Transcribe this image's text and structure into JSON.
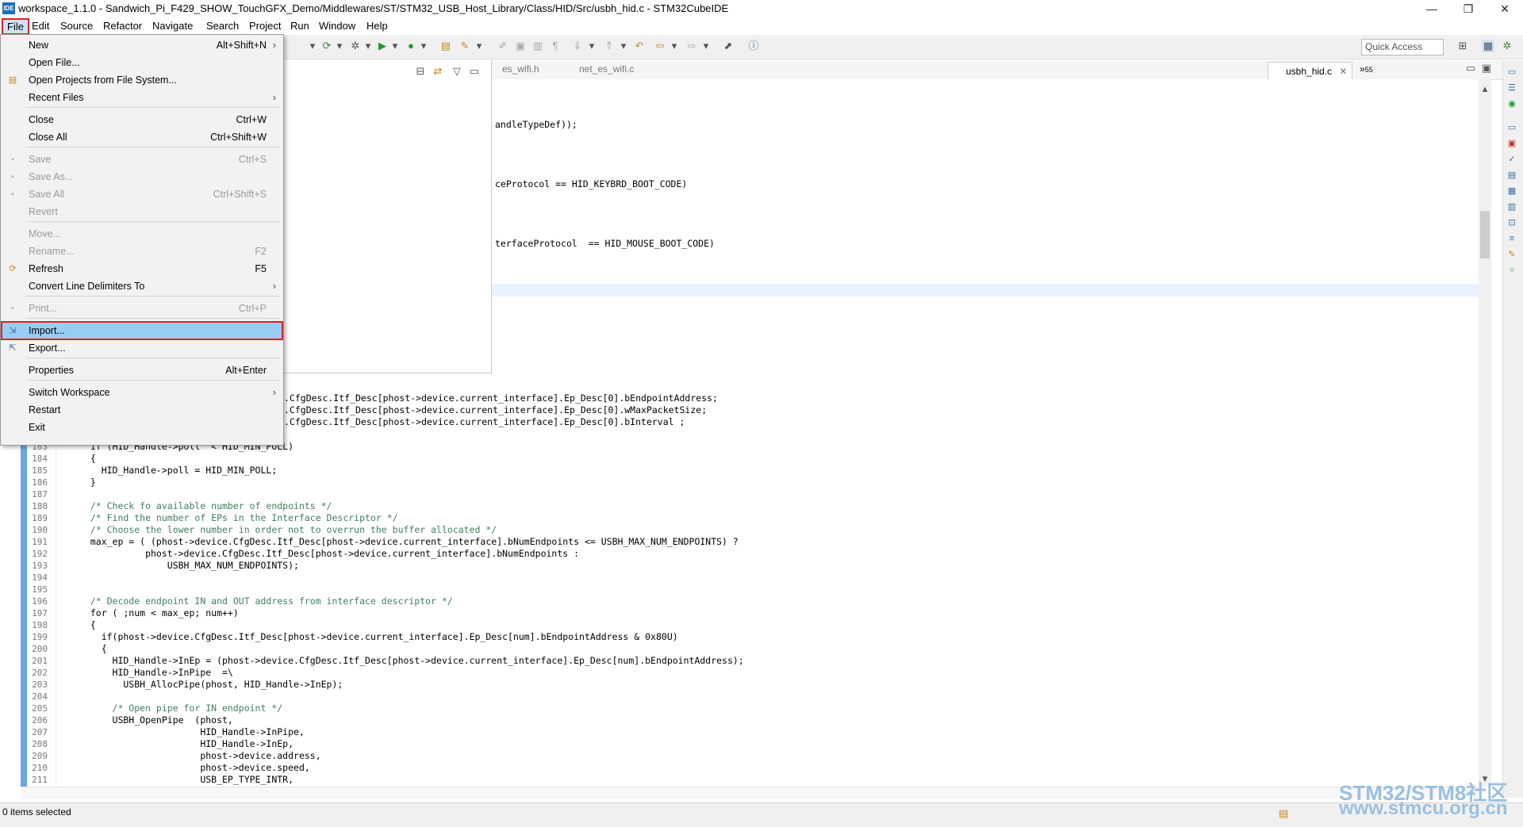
{
  "window": {
    "title": "workspace_1.1.0 - Sandwich_Pi_F429_SHOW_TouchGFX_Demo/Middlewares/ST/STM32_USB_Host_Library/Class/HID/Src/usbh_hid.c - STM32CubeIDE",
    "app_icon": "IDE",
    "minimize": "—",
    "maximize": "❐",
    "close": "✕"
  },
  "menubar": [
    "File",
    "Edit",
    "Source",
    "Refactor",
    "Navigate",
    "Search",
    "Project",
    "Run",
    "Window",
    "Help"
  ],
  "toolbar": {
    "quick_access_placeholder": "Quick Access"
  },
  "tabs": {
    "tab1": "es_wifi.h",
    "tab2": "net_es_wifi.c",
    "active": "usbh_hid.c",
    "overflow": "»",
    "overflow_count": "55"
  },
  "file_menu": {
    "items": [
      {
        "label": "New",
        "shortcut": "Alt+Shift+N",
        "submenu": true,
        "enabled": true
      },
      {
        "label": "Open File...",
        "shortcut": "",
        "enabled": true
      },
      {
        "label": "Open Projects from File System...",
        "shortcut": "",
        "enabled": true
      },
      {
        "label": "Recent Files",
        "shortcut": "",
        "submenu": true,
        "enabled": true
      },
      {
        "label": "Close",
        "shortcut": "Ctrl+W",
        "enabled": true
      },
      {
        "label": "Close All",
        "shortcut": "Ctrl+Shift+W",
        "enabled": true
      },
      {
        "label": "Save",
        "shortcut": "Ctrl+S",
        "enabled": false
      },
      {
        "label": "Save As...",
        "shortcut": "",
        "enabled": false
      },
      {
        "label": "Save All",
        "shortcut": "Ctrl+Shift+S",
        "enabled": false
      },
      {
        "label": "Revert",
        "shortcut": "",
        "enabled": false
      },
      {
        "label": "Move...",
        "shortcut": "",
        "enabled": false
      },
      {
        "label": "Rename...",
        "shortcut": "F2",
        "enabled": false
      },
      {
        "label": "Refresh",
        "shortcut": "F5",
        "enabled": true
      },
      {
        "label": "Convert Line Delimiters To",
        "shortcut": "",
        "submenu": true,
        "enabled": true
      },
      {
        "label": "Print...",
        "shortcut": "Ctrl+P",
        "enabled": false
      },
      {
        "label": "Import...",
        "shortcut": "",
        "enabled": true,
        "highlighted": true
      },
      {
        "label": "Export...",
        "shortcut": "",
        "enabled": true
      },
      {
        "label": "Properties",
        "shortcut": "Alt+Enter",
        "enabled": true
      },
      {
        "label": "Switch Workspace",
        "shortcut": "",
        "submenu": true,
        "enabled": true
      },
      {
        "label": "Restart",
        "shortcut": "",
        "enabled": true
      },
      {
        "label": "Exit",
        "shortcut": "",
        "enabled": true
      }
    ]
  },
  "code_fragments_top": [
    "andleTypeDef));",
    "ceProtocol == HID_KEYBRD_BOOT_CODE)",
    "terfaceProtocol  == HID_MOUSE_BOOT_CODE)"
  ],
  "code_fragments_mid": [
    ".CfgDesc.Itf_Desc[phost->device.current_interface].Ep_Desc[0].bEndpointAddress;",
    ".CfgDesc.Itf_Desc[phost->device.current_interface].Ep_Desc[0].wMaxPacketSize;",
    ".CfgDesc.Itf_Desc[phost->device.current_interface].Ep_Desc[0].bInterval ;"
  ],
  "code_lines": [
    {
      "n": "183",
      "t": "  if (HID_Handle->poll  < HID_MIN_POLL)"
    },
    {
      "n": "184",
      "t": "  {"
    },
    {
      "n": "185",
      "t": "    HID_Handle->poll = HID_MIN_POLL;"
    },
    {
      "n": "186",
      "t": "  }"
    },
    {
      "n": "187",
      "t": ""
    },
    {
      "n": "188",
      "t": "  /* Check fo available number of endpoints */"
    },
    {
      "n": "189",
      "t": "  /* Find the number of EPs in the Interface Descriptor */"
    },
    {
      "n": "190",
      "t": "  /* Choose the lower number in order not to overrun the buffer allocated */"
    },
    {
      "n": "191",
      "t": "  max_ep = ( (phost->device.CfgDesc.Itf_Desc[phost->device.current_interface].bNumEndpoints <= USBH_MAX_NUM_ENDPOINTS) ?"
    },
    {
      "n": "192",
      "t": "            phost->device.CfgDesc.Itf_Desc[phost->device.current_interface].bNumEndpoints :"
    },
    {
      "n": "193",
      "t": "                USBH_MAX_NUM_ENDPOINTS);"
    },
    {
      "n": "194",
      "t": ""
    },
    {
      "n": "195",
      "t": ""
    },
    {
      "n": "196",
      "t": "  /* Decode endpoint IN and OUT address from interface descriptor */"
    },
    {
      "n": "197",
      "t": "  for ( ;num < max_ep; num++)"
    },
    {
      "n": "198",
      "t": "  {"
    },
    {
      "n": "199",
      "t": "    if(phost->device.CfgDesc.Itf_Desc[phost->device.current_interface].Ep_Desc[num].bEndpointAddress & 0x80U)"
    },
    {
      "n": "200",
      "t": "    {"
    },
    {
      "n": "201",
      "t": "      HID_Handle->InEp = (phost->device.CfgDesc.Itf_Desc[phost->device.current_interface].Ep_Desc[num].bEndpointAddress);"
    },
    {
      "n": "202",
      "t": "      HID_Handle->InPipe  =\\"
    },
    {
      "n": "203",
      "t": "        USBH_AllocPipe(phost, HID_Handle->InEp);"
    },
    {
      "n": "204",
      "t": ""
    },
    {
      "n": "205",
      "t": "      /* Open pipe for IN endpoint */"
    },
    {
      "n": "206",
      "t": "      USBH_OpenPipe  (phost,"
    },
    {
      "n": "207",
      "t": "                      HID_Handle->InPipe,"
    },
    {
      "n": "208",
      "t": "                      HID_Handle->InEp,"
    },
    {
      "n": "209",
      "t": "                      phost->device.address,"
    },
    {
      "n": "210",
      "t": "                      phost->device.speed,"
    },
    {
      "n": "211",
      "t": "                      USB_EP_TYPE_INTR,"
    }
  ],
  "status": {
    "text": "0 items selected"
  },
  "watermark": {
    "line1": "STM32/STM8社区",
    "line2": "www.stmcu.org.cn"
  },
  "colors": {
    "accent": "#99ccf3",
    "highlight_border": "#e02020",
    "gutter": "#6aa7dc"
  }
}
